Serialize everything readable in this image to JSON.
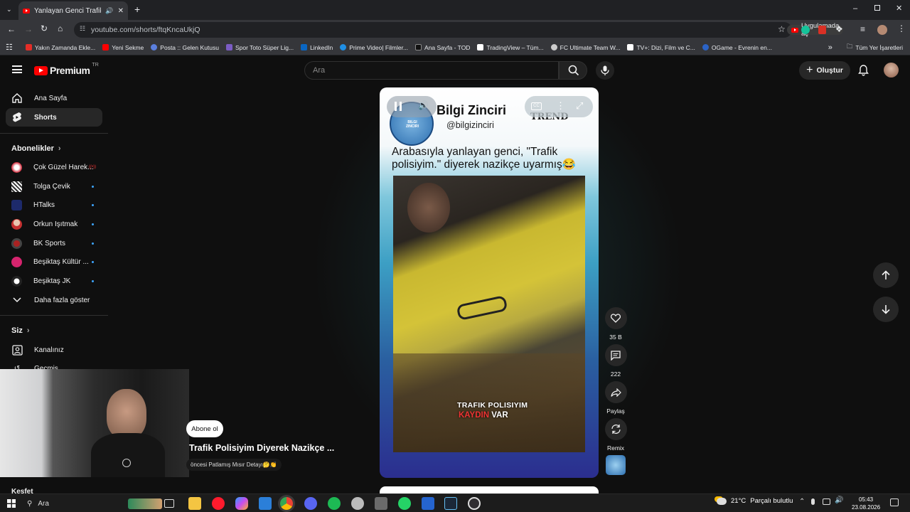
{
  "browser": {
    "tab_title": "Yanlayan Genci Trafik Polisi",
    "url": "youtube.com/shorts/ftqKncaUkjQ",
    "open_in_app": "Uygulamada aç",
    "bookmarks": [
      "Yakın Zamanda Ekle...",
      "Yeni Sekme",
      "Posta :: Gelen Kutusu",
      "Spor Toto Süper Lig...",
      "LinkedIn",
      "Prime Video| Filmler...",
      "Ana Sayfa - TOD",
      "TradingView – Tüm...",
      "FC Ultimate Team W...",
      "TV+: Dizi, Film ve C...",
      "OGame - Evrenin en..."
    ],
    "all_bookmarks": "Tüm Yer İşaretleri"
  },
  "youtube": {
    "logo_text": "Premium",
    "logo_badge": "TR",
    "search_placeholder": "Ara",
    "create_label": "Oluştur",
    "accent": "#ff0000"
  },
  "sidebar": {
    "home": "Ana Sayfa",
    "shorts": "Shorts",
    "subscriptions_header": "Abonelikler",
    "subscriptions": [
      {
        "name": "Çok Güzel Harek...",
        "live": true
      },
      {
        "name": "Tolga Çevik",
        "dot": true
      },
      {
        "name": "HTalks",
        "dot": true
      },
      {
        "name": "Orkun Işıtmak",
        "dot": true
      },
      {
        "name": "BK Sports",
        "dot": true
      },
      {
        "name": "Beşiktaş Kültür ...",
        "dot": true
      },
      {
        "name": "Beşiktaş JK",
        "dot": true
      }
    ],
    "show_more": "Daha fazla göster",
    "you_header": "Siz",
    "your_channel": "Kanalınız",
    "history": "Geçmiş",
    "explore": "Keşfet"
  },
  "short": {
    "channel_name": "Bilgi Zinciri",
    "channel_handle": "@bilgizinciri",
    "trend": "TREND",
    "headline": "Arabasıyla yanlayan genci, \"Trafik polisiyim.\" diyerek nazikçe uyarmış😂",
    "caption_line1": "TRAFIK POLISIYIM",
    "caption_red": "KAYDIN",
    "caption_white": "VAR",
    "subscribe": "Abone ol",
    "title": "Trafik Polisiyim Diyerek Nazikçe ...",
    "description": "öncesi Patlamış Mısır Detayı🤔👏",
    "likes": "35 B",
    "comments": "222",
    "share": "Paylaş",
    "remix": "Remix"
  },
  "taskbar": {
    "search": "Ara",
    "temperature": "21°C",
    "weather": "Parçalı bulutlu",
    "time": "05:43",
    "date": "23.08.2026"
  }
}
